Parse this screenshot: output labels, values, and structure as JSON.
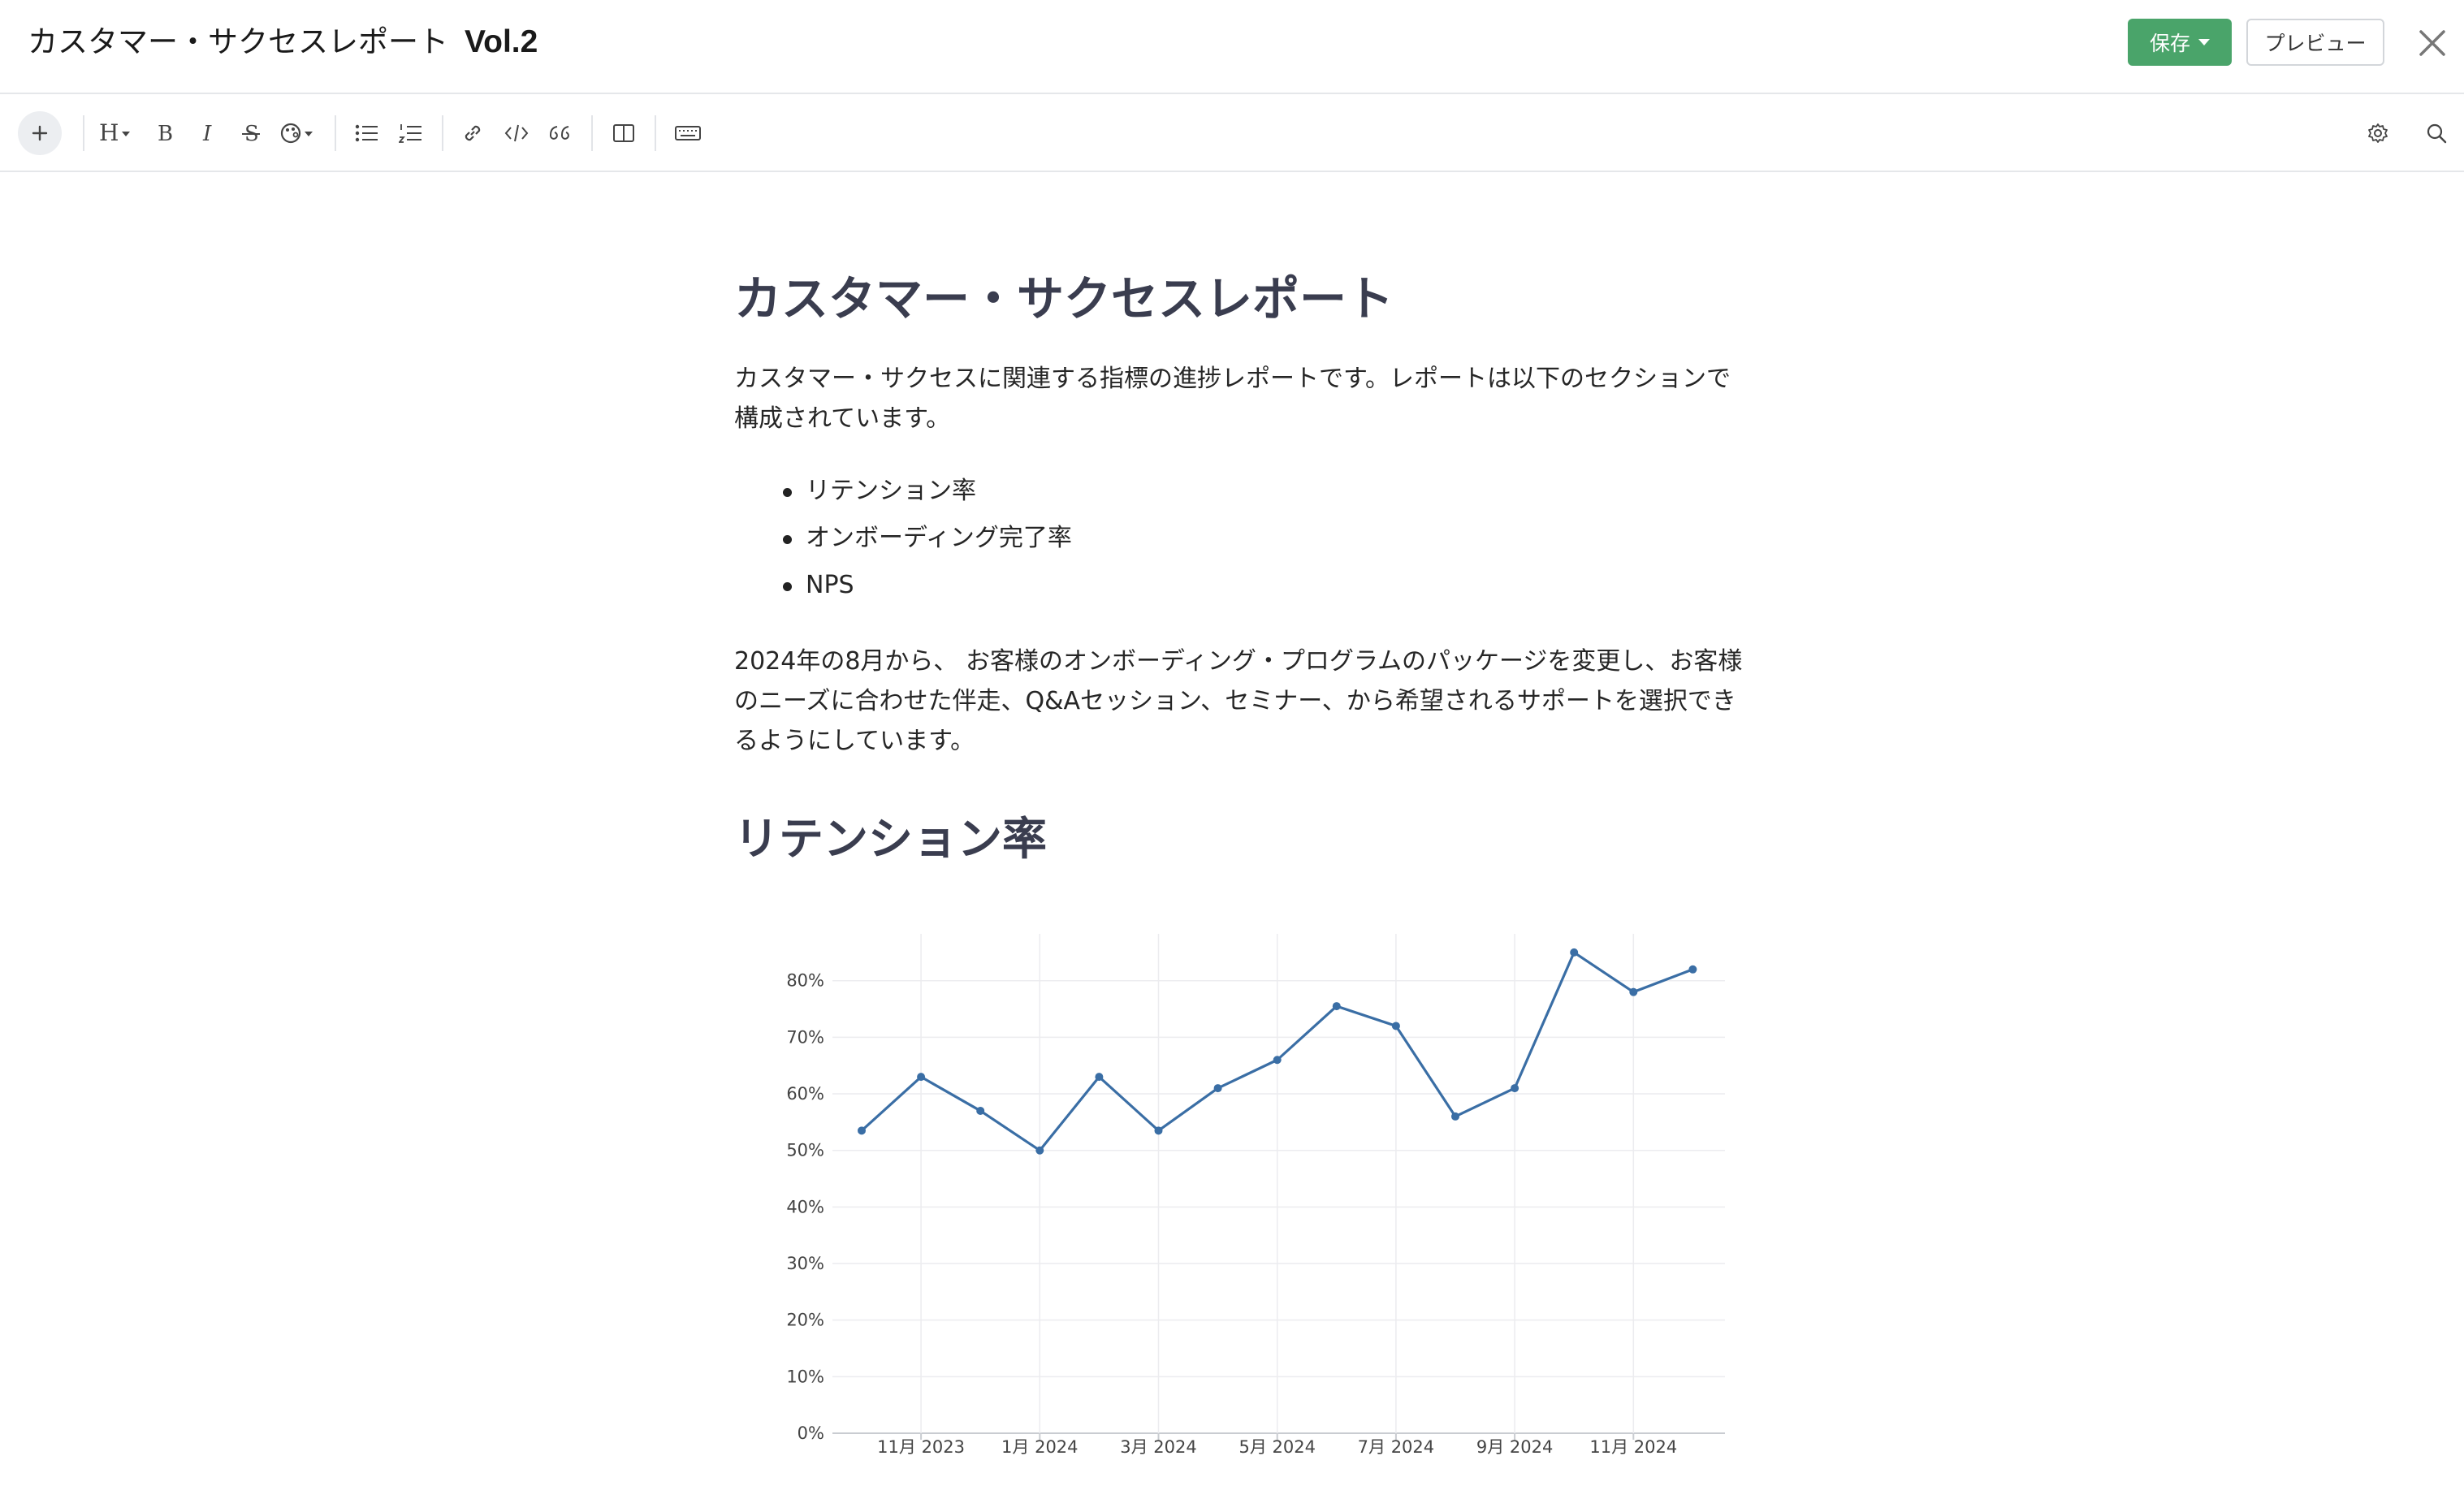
{
  "header": {
    "title": "カスタマー・サクセスレポート",
    "title_suffix": "Vol.2",
    "save_label": "保存",
    "preview_label": "プレビュー",
    "close_icon": "close-icon"
  },
  "toolbar": {
    "items": [
      "add-block-icon",
      "heading-icon",
      "bold-icon",
      "italic-icon",
      "strikethrough-icon",
      "color-palette-icon",
      "bullet-list-icon",
      "numbered-list-icon",
      "link-icon",
      "code-icon",
      "quote-icon",
      "layout-columns-icon",
      "keyboard-icon"
    ],
    "right_items": [
      "settings-gear-icon",
      "search-icon"
    ]
  },
  "doc": {
    "heading": "カスタマー・サクセスレポート",
    "intro_line1": "カスタマー・サクセスに関連する指標の進捗レポートです。レポートは以下のセクションで",
    "intro_line2": "構成されています。",
    "bullets": [
      "リテンション率",
      "オンボーディング完了率",
      "NPS"
    ],
    "para2_line1": "2024年の8月から、 お客様のオンボーディング・プログラムのパッケージを変更し、お客様",
    "para2_line2": "のニーズに合わせた伴走、Q&Aセッション、セミナー、から希望されるサポートを選択でき",
    "para2_line3": "るようにしています。",
    "section1_heading": "リテンション率"
  },
  "chart_data": {
    "type": "line",
    "title": "",
    "xlabel": "",
    "ylabel": "",
    "x": [
      "2023-10",
      "2023-11",
      "2023-12",
      "2024-01",
      "2024-02",
      "2024-03",
      "2024-04",
      "2024-05",
      "2024-06",
      "2024-07",
      "2024-08",
      "2024-09",
      "2024-10",
      "2024-11",
      "2024-12"
    ],
    "series": [
      {
        "values": [
          53.5,
          63,
          57,
          50,
          63,
          53.5,
          61,
          66,
          75.5,
          72,
          56,
          61,
          85,
          78,
          82
        ]
      }
    ],
    "ylim": [
      0,
      88
    ],
    "yticks": [
      0,
      10,
      20,
      30,
      40,
      50,
      60,
      70,
      80
    ],
    "ytick_labels": [
      "0%",
      "10%",
      "20%",
      "30%",
      "40%",
      "50%",
      "60%",
      "70%",
      "80%"
    ],
    "xtick_positions": [
      "2023-11",
      "2024-01",
      "2024-03",
      "2024-05",
      "2024-07",
      "2024-09",
      "2024-11"
    ],
    "xtick_labels": [
      "11月 2023",
      "1月 2024",
      "3月 2024",
      "5月 2024",
      "7月 2024",
      "9月 2024",
      "11月 2024"
    ],
    "grid": true,
    "line_color": "#3a6ea5"
  }
}
